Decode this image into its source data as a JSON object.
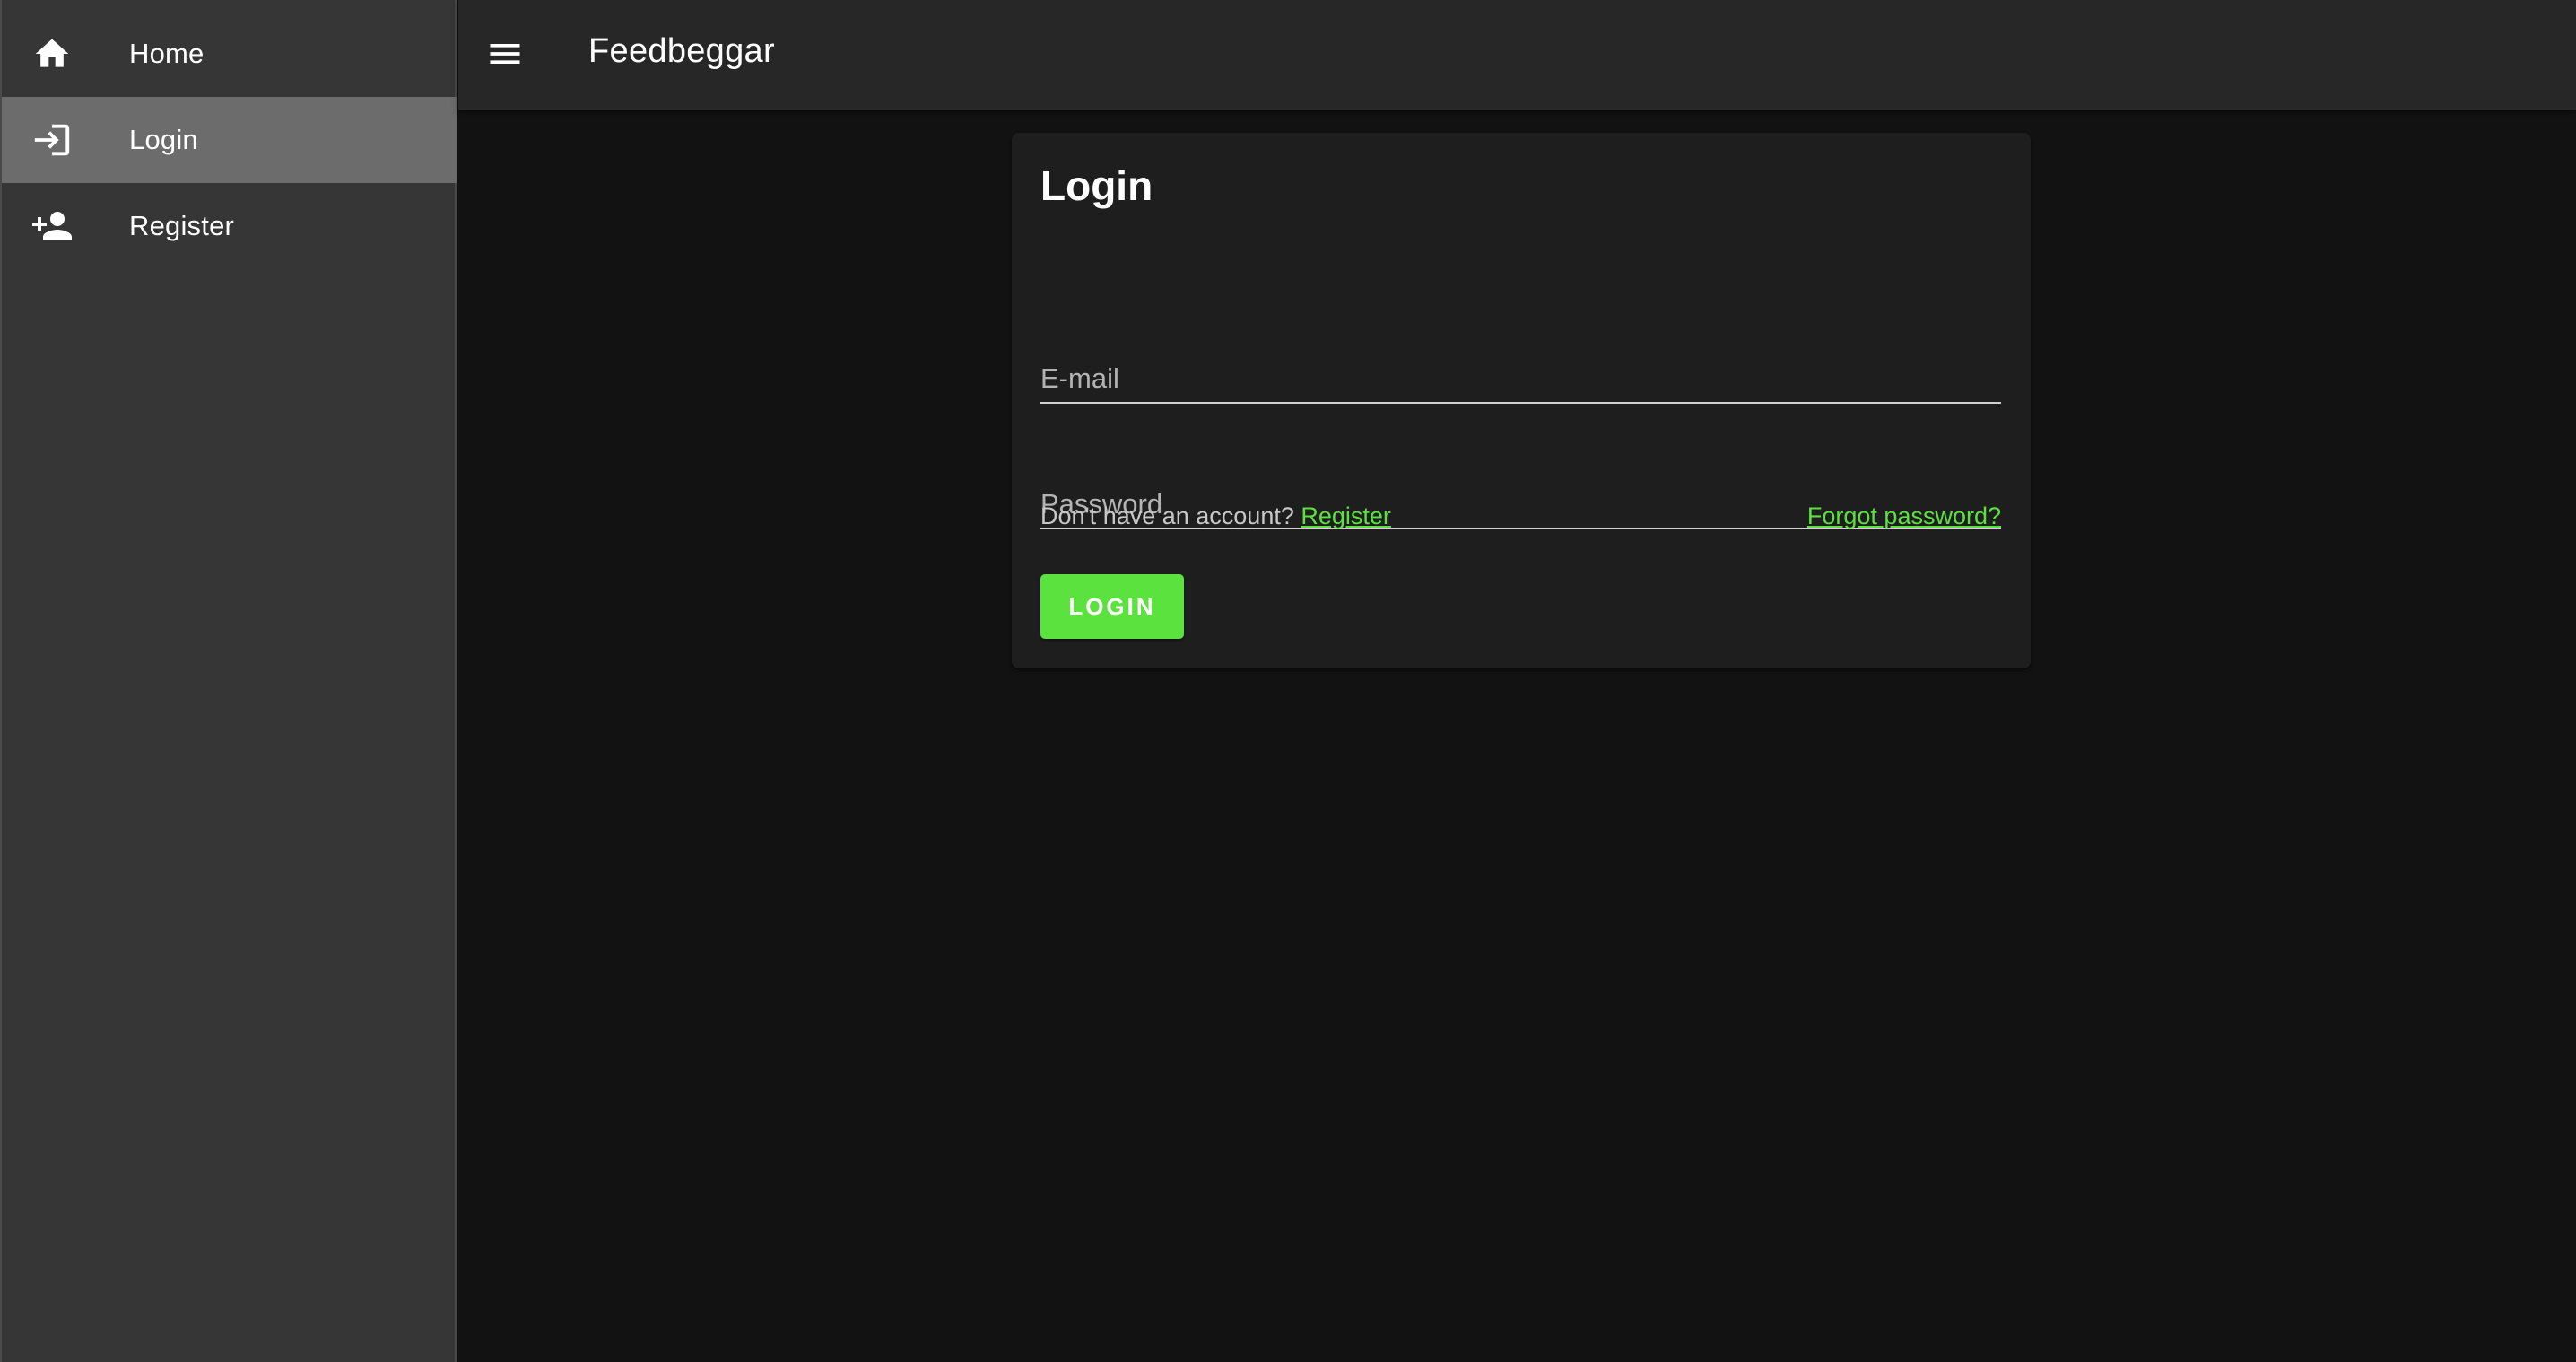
{
  "app": {
    "title": "Feedbeggar",
    "accent_color": "#5ce23f"
  },
  "topbar": {
    "menu_icon": "menu-icon"
  },
  "sidebar": {
    "items": [
      {
        "label": "Home",
        "icon": "home-icon",
        "active": false
      },
      {
        "label": "Login",
        "icon": "login-icon",
        "active": true
      },
      {
        "label": "Register",
        "icon": "person-add-icon",
        "active": false
      }
    ]
  },
  "login_form": {
    "title": "Login",
    "email": {
      "value": "",
      "placeholder": "E-mail"
    },
    "password": {
      "value": "",
      "placeholder": "Password"
    },
    "no_account_text": "Don't have an account?",
    "register_link": "Register",
    "forgot_link": "Forgot password?",
    "submit_label": "LOGIN"
  }
}
